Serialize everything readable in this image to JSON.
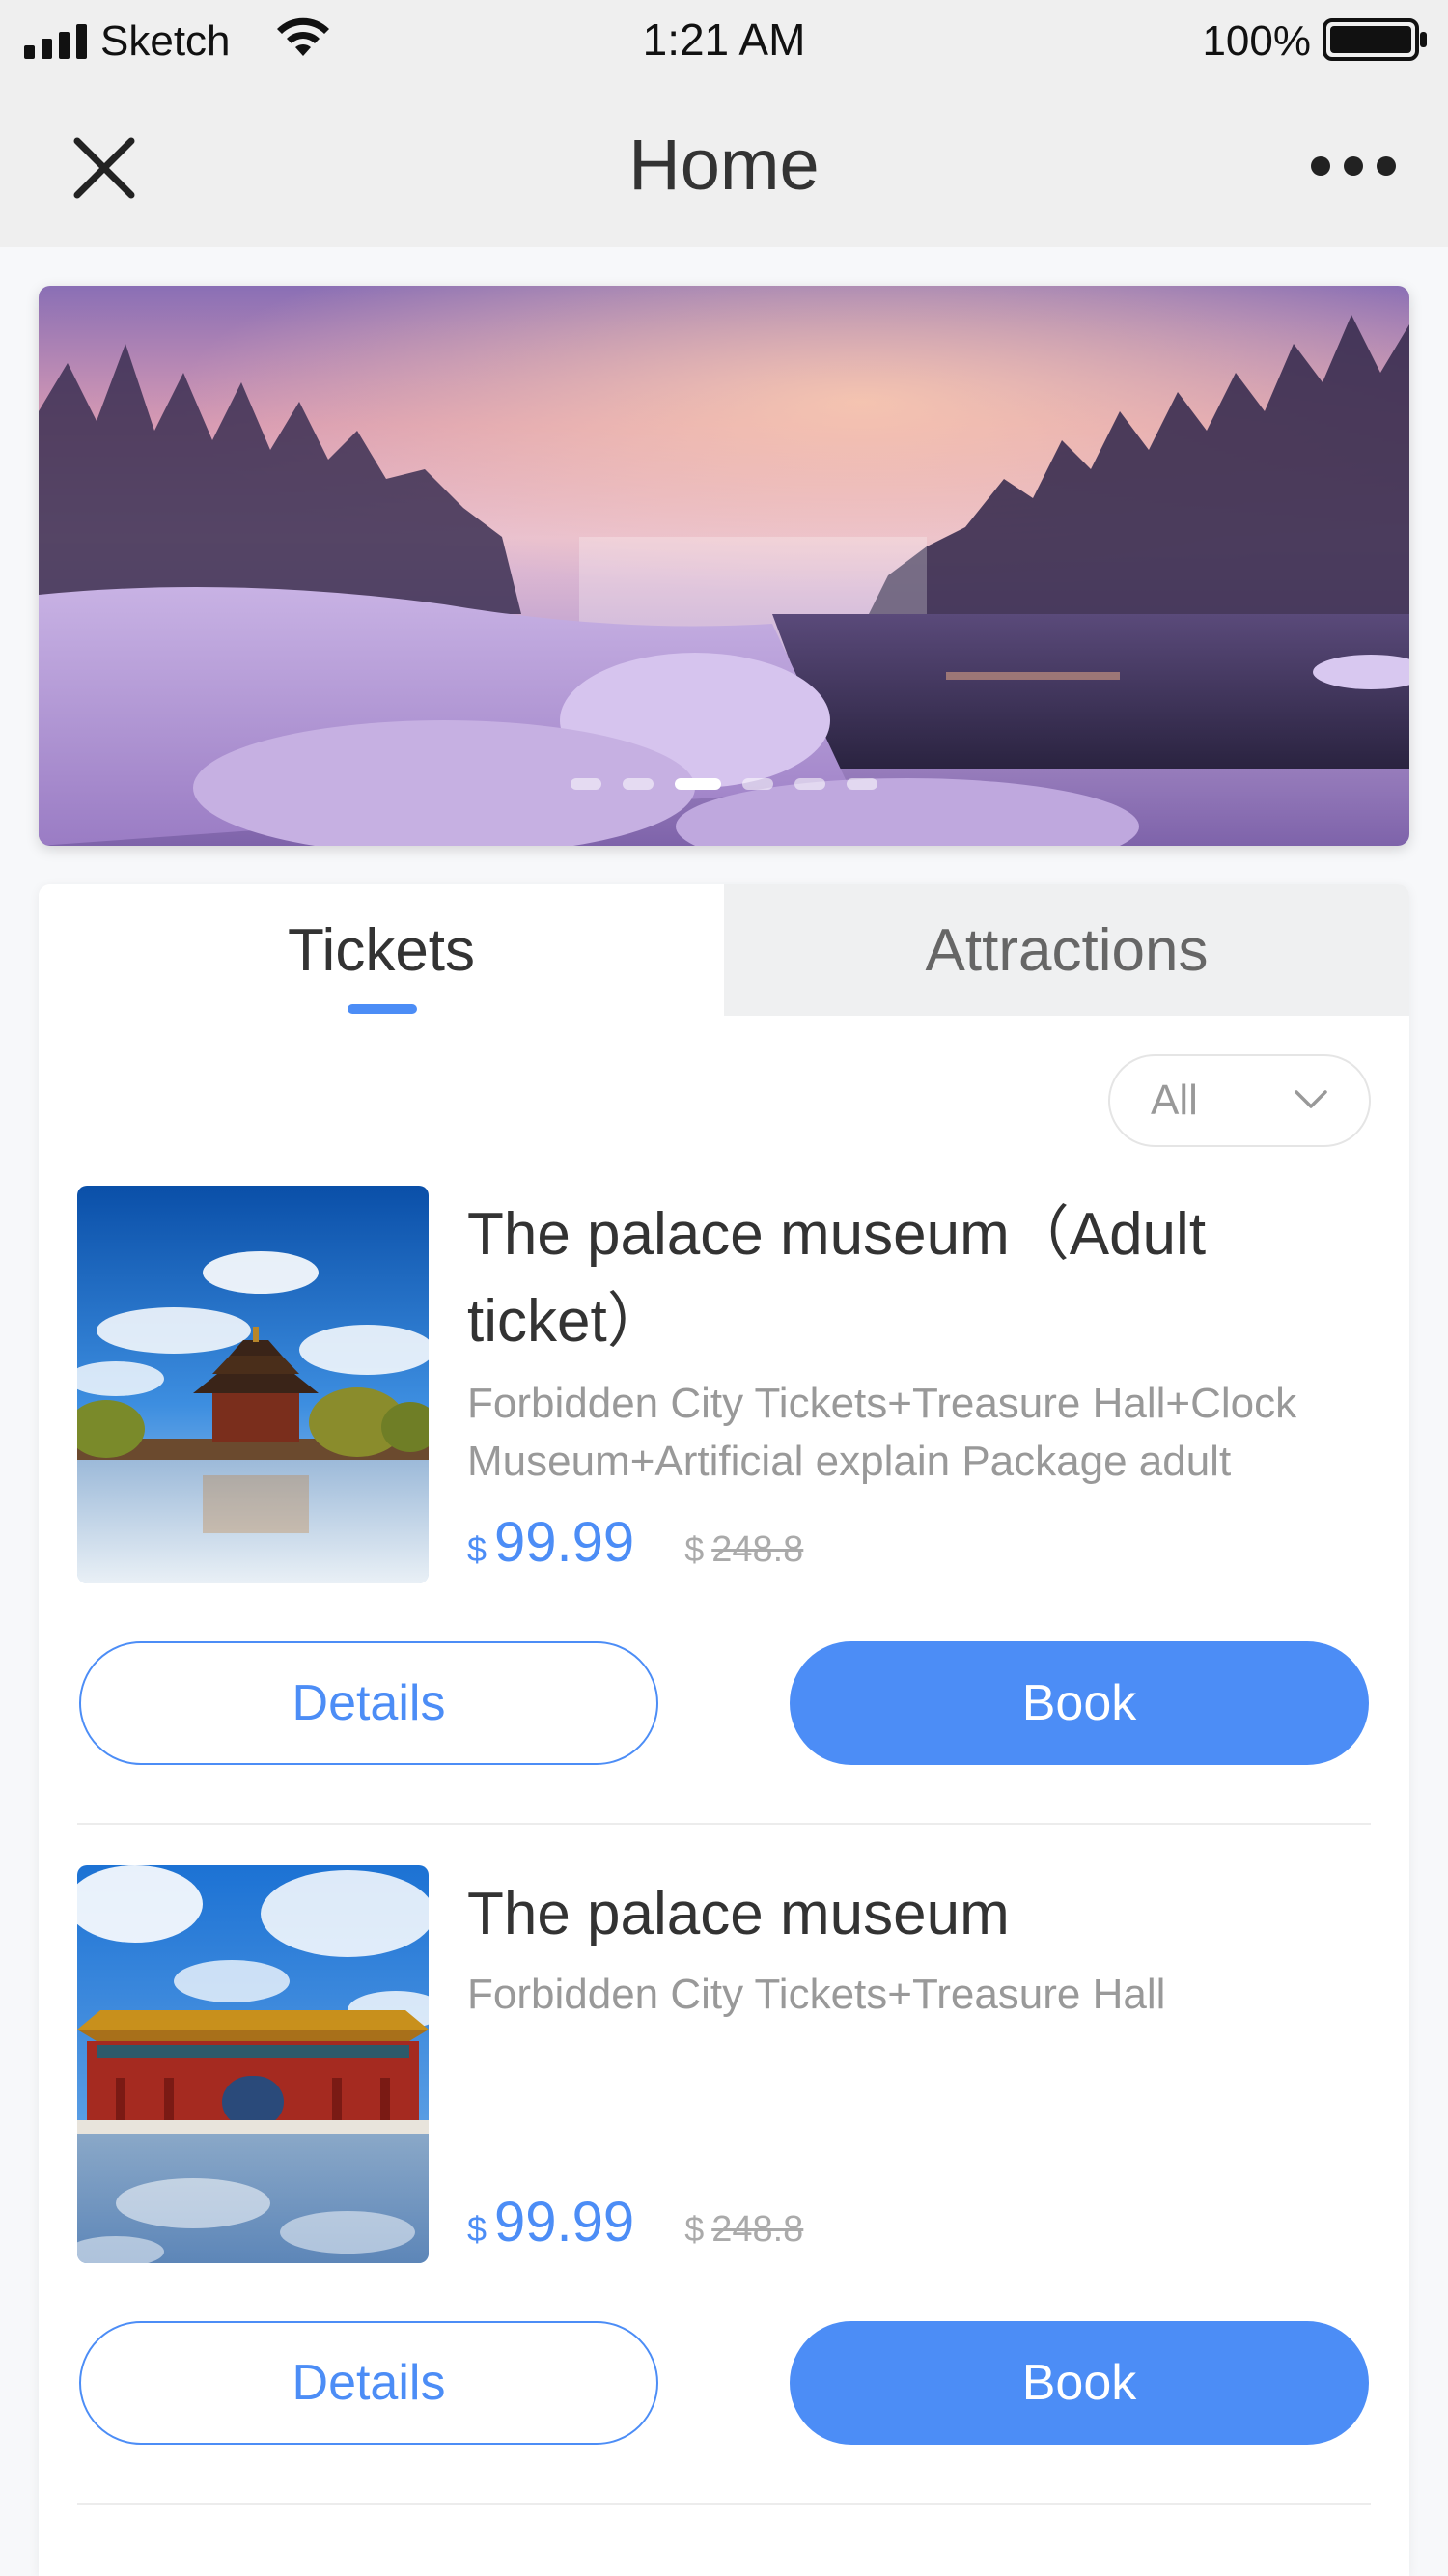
{
  "status_bar": {
    "carrier": "Sketch",
    "time": "1:21 AM",
    "battery": "100%"
  },
  "nav": {
    "title": "Home",
    "close_icon": "close-icon",
    "more_icon": "more-dots-icon"
  },
  "banner": {
    "dot_count": 6,
    "active_index": 2
  },
  "tabs": [
    {
      "label": "Tickets",
      "active": true
    },
    {
      "label": "Attractions",
      "active": false
    }
  ],
  "filter": {
    "selected": "All"
  },
  "items": [
    {
      "title": "The palace museum（Adult ticket）",
      "description": "Forbidden City Tickets+Treasure Hall+Clock Museum+Artificial explain Package adult",
      "currency": "$",
      "price": "99.99",
      "old_currency": "$",
      "old_price": "248.8",
      "details_label": "Details",
      "book_label": "Book"
    },
    {
      "title": "The palace museum",
      "description": "Forbidden City Tickets+Treasure Hall",
      "currency": "$",
      "price": "99.99",
      "old_currency": "$",
      "old_price": "248.8",
      "details_label": "Details",
      "book_label": "Book"
    }
  ],
  "colors": {
    "accent": "#4c8df6",
    "bar_bg": "#efefef"
  }
}
